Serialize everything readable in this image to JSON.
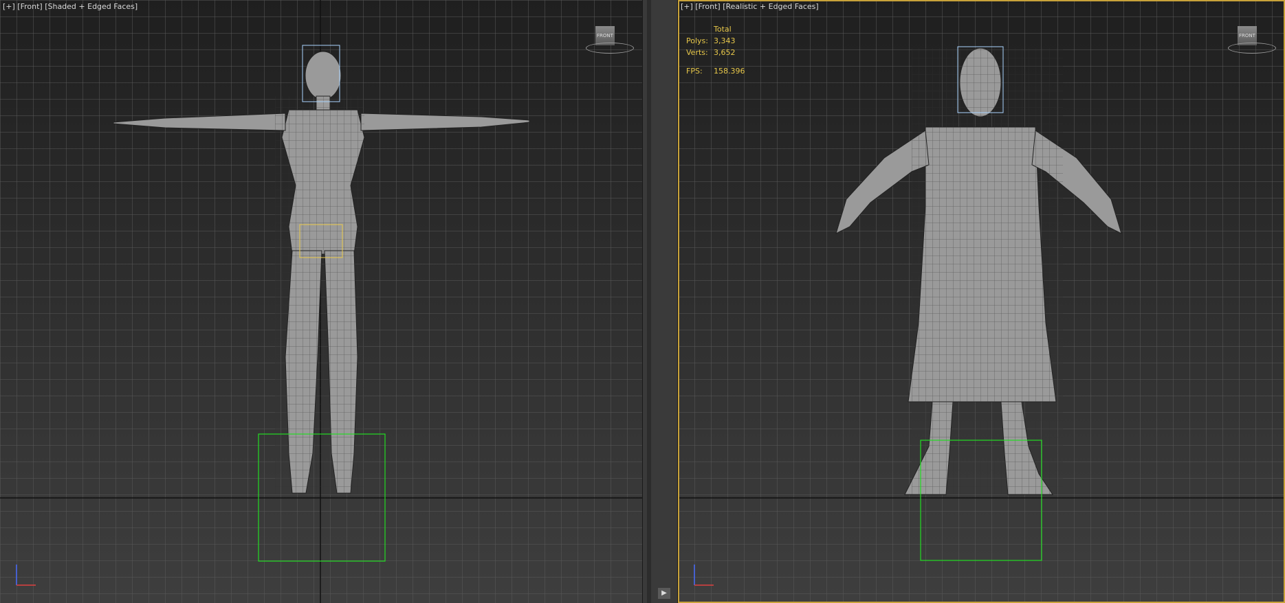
{
  "left_viewport": {
    "label": "[+] [Front] [Shaded + Edged Faces]",
    "viewcube_label": "FRONT"
  },
  "right_viewport": {
    "label": "[+] [Front] [Realistic + Edged Faces]",
    "viewcube_label": "FRONT",
    "stats": {
      "header": "Total",
      "polys_label": "Polys:",
      "polys_value": "3,343",
      "verts_label": "Verts:",
      "verts_value": "3,652",
      "fps_label": "FPS:",
      "fps_value": "158.396"
    }
  },
  "colors": {
    "active_border": "#c8a23a",
    "stats_text": "#e8c84a",
    "grid": "#5a5a5a",
    "selection_green": "#22dd22"
  },
  "timeline": {
    "play_icon": "play-icon"
  }
}
